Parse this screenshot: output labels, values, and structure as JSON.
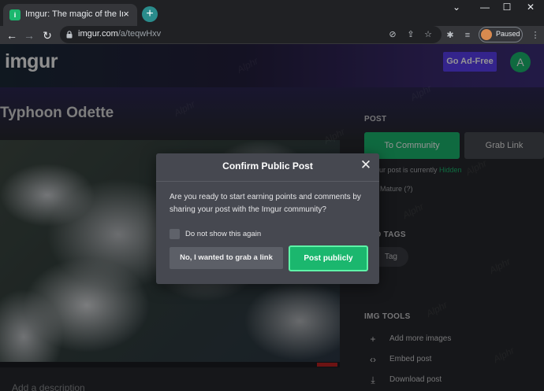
{
  "browser": {
    "tab_title": "Imgur: The magic of the Internet",
    "tab_close": "×",
    "new_tab": "+",
    "url_host": "imgur.com",
    "url_path": "/a/teqwHxv",
    "profile_status": "Paused",
    "window_controls": [
      "⌄",
      "—",
      "☐",
      "✕"
    ]
  },
  "header": {
    "logo_text": "imgur",
    "go_adfree_label": "Go Ad-Free",
    "avatar_initial": "A",
    "accent_color": "#1bb76e",
    "adfree_color": "#5b3ff2"
  },
  "post": {
    "title": "Typhoon Odette",
    "description_placeholder": "Add a description"
  },
  "sidebar": {
    "post_section_label": "POST",
    "to_community_label": "To Community",
    "grab_link_label": "Grab Link",
    "status_prefix": "our post is currently",
    "status_value": "Hidden",
    "mature_label": "Mature (?)",
    "tags_label": "D TAGS",
    "tag_label": "Tag",
    "img_tools_label": "IMG TOOLS",
    "tools": [
      {
        "label": "Add more images",
        "icon": "plus-icon"
      },
      {
        "label": "Embed post",
        "icon": "code-icon"
      },
      {
        "label": "Download post",
        "icon": "download-icon"
      }
    ]
  },
  "watermark_text": "Alphr",
  "dialog": {
    "title": "Confirm Public Post",
    "close": "✕",
    "body": "Are you ready to start earning points and comments by sharing your post with the Imgur community?",
    "checkbox_label": "Do not show this again",
    "grab_link_button": "No, I wanted to grab a link",
    "post_publicly_button": "Post publicly"
  }
}
